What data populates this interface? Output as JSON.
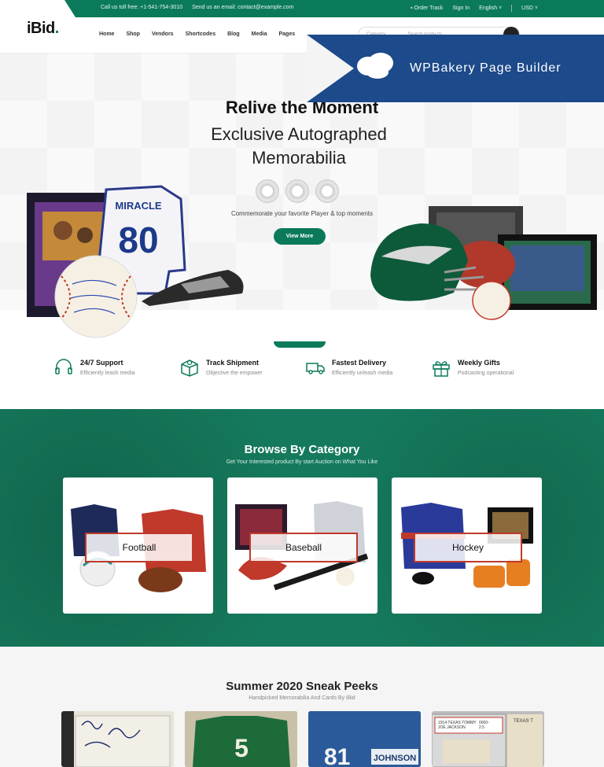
{
  "topbar": {
    "phone": "Call us toll free: +1-541-754-3010",
    "email": "Send us an email: contact@example.com",
    "order_track": "Order Track",
    "sign_in": "Sign In",
    "language": "English",
    "currency": "USD"
  },
  "header": {
    "logo": "iBid",
    "nav": [
      "Home",
      "Shop",
      "Vendors",
      "Shortcodes",
      "Blog",
      "Media",
      "Pages"
    ],
    "search_category": "Category",
    "search_placeholder": "Search products..."
  },
  "banner": {
    "title": "WPBakery Page Builder"
  },
  "hero": {
    "title": "Relive the Moment",
    "subtitle": "Exclusive Autographed Memorabilia",
    "text": "Commemorate your favorite Player & top moments",
    "button": "View More",
    "jersey_name": "MIRACLE",
    "jersey_number": "80"
  },
  "features": [
    {
      "icon": "headset-icon",
      "title": "24/7 Support",
      "desc": "Efficiently leash media"
    },
    {
      "icon": "box-icon",
      "title": "Track Shipment",
      "desc": "Objective the empower"
    },
    {
      "icon": "truck-icon",
      "title": "Fastest Delivery",
      "desc": "Efficiently unleash media"
    },
    {
      "icon": "gift-icon",
      "title": "Weekly Gifts",
      "desc": "Podcasting operational"
    }
  ],
  "categories": {
    "title": "Browse By Category",
    "subtitle": "Get Your Interested product By start Auction on What You Like",
    "items": [
      {
        "label": "Football"
      },
      {
        "label": "Baseball"
      },
      {
        "label": "Hockey"
      }
    ]
  },
  "peeks": {
    "title": "Summer 2020 Sneak Peeks",
    "subtitle": "Handpicked Memorabilia And Cards By iBid"
  },
  "colors": {
    "brand": "#0b7a5a",
    "wpbakery": "#1c4a8a"
  }
}
